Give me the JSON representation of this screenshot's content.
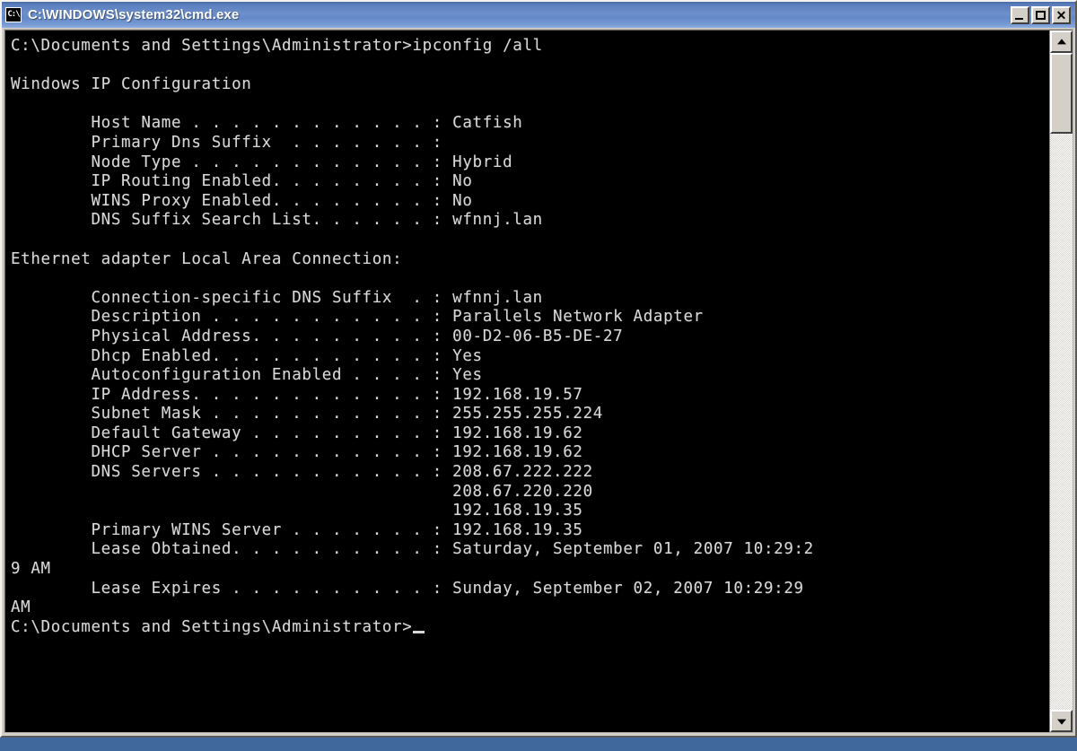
{
  "window": {
    "title": "C:\\WINDOWS\\system32\\cmd.exe",
    "icon_label": "C:\\",
    "icon_name": "cmd-console-icon",
    "accent_color": "#6e90cc",
    "frame_color": "#d4d0c8",
    "background_color": "#000000",
    "foreground_color": "#d8d8d8",
    "desktop_color": "#41689c",
    "buttons": {
      "minimize": "_",
      "maximize": "□",
      "close": "✕"
    }
  },
  "scrollbar": {
    "up_arrow": "▲",
    "down_arrow": "▼",
    "thumb_position": "top"
  },
  "console": {
    "prompt": "C:\\Documents and Settings\\Administrator>",
    "command": "ipconfig /all",
    "cursor": "_",
    "lines": [
      "C:\\Documents and Settings\\Administrator>ipconfig /all",
      "",
      "Windows IP Configuration",
      "",
      "        Host Name . . . . . . . . . . . . : Catfish",
      "        Primary Dns Suffix  . . . . . . . :",
      "        Node Type . . . . . . . . . . . . : Hybrid",
      "        IP Routing Enabled. . . . . . . . : No",
      "        WINS Proxy Enabled. . . . . . . . : No",
      "        DNS Suffix Search List. . . . . . : wfnnj.lan",
      "",
      "Ethernet adapter Local Area Connection:",
      "",
      "        Connection-specific DNS Suffix  . : wfnnj.lan",
      "        Description . . . . . . . . . . . : Parallels Network Adapter",
      "        Physical Address. . . . . . . . . : 00-D2-06-B5-DE-27",
      "        Dhcp Enabled. . . . . . . . . . . : Yes",
      "        Autoconfiguration Enabled . . . . : Yes",
      "        IP Address. . . . . . . . . . . . : 192.168.19.57",
      "        Subnet Mask . . . . . . . . . . . : 255.255.255.224",
      "        Default Gateway . . . . . . . . . : 192.168.19.62",
      "        DHCP Server . . . . . . . . . . . : 192.168.19.62",
      "        DNS Servers . . . . . . . . . . . : 208.67.222.222",
      "                                            208.67.220.220",
      "                                            192.168.19.35",
      "        Primary WINS Server . . . . . . . : 192.168.19.35",
      "        Lease Obtained. . . . . . . . . . : Saturday, September 01, 2007 10:29:2",
      "9 AM",
      "        Lease Expires . . . . . . . . . . : Sunday, September 02, 2007 10:29:29",
      "AM",
      ""
    ],
    "fields": {
      "host_name": "Catfish",
      "primary_dns_suffix": "",
      "node_type": "Hybrid",
      "ip_routing_enabled": "No",
      "wins_proxy_enabled": "No",
      "dns_suffix_search_list": "wfnnj.lan",
      "adapter_name": "Ethernet adapter Local Area Connection",
      "connection_specific_dns_suffix": "wfnnj.lan",
      "description": "Parallels Network Adapter",
      "physical_address": "00-D2-06-B5-DE-27",
      "dhcp_enabled": "Yes",
      "autoconfiguration_enabled": "Yes",
      "ip_address": "192.168.19.57",
      "subnet_mask": "255.255.255.224",
      "default_gateway": "192.168.19.62",
      "dhcp_server": "192.168.19.62",
      "dns_servers": [
        "208.67.222.222",
        "208.67.220.220",
        "192.168.19.35"
      ],
      "primary_wins_server": "192.168.19.35",
      "lease_obtained": "Saturday, September 01, 2007 10:29:29 AM",
      "lease_expires": "Sunday, September 02, 2007 10:29:29 AM"
    }
  }
}
